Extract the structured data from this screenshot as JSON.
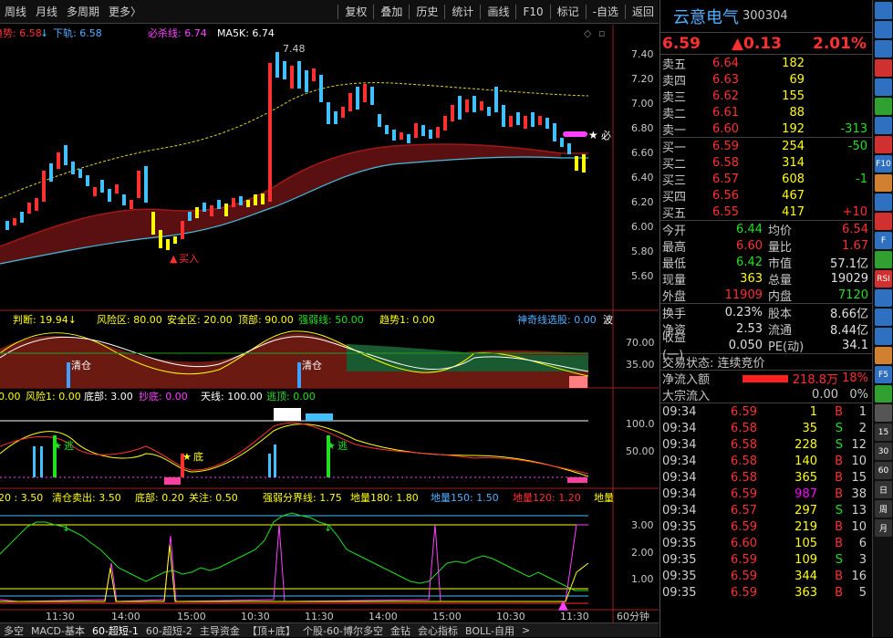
{
  "toolbar": {
    "left": [
      "周线",
      "月线",
      "多周期",
      "更多〉"
    ],
    "right": [
      "复权",
      "叠加",
      "历史",
      "统计",
      "画线",
      "F10",
      "标记",
      "-自选",
      "返回"
    ]
  },
  "main_chart": {
    "legend": [
      {
        "text": "趋势: 6.58",
        "color": "#ff3030"
      },
      {
        "text": "↓",
        "color": "#20c0ff"
      },
      {
        "text": "下轨: 6.58",
        "color": "#50b0ff"
      },
      {
        "text": "必杀线: 6.74",
        "color": "#ff40ff"
      },
      {
        "text": "MA5K: 6.74",
        "color": "#ffffff"
      }
    ],
    "y_labels": [
      "7.40",
      "7.20",
      "7.00",
      "6.80",
      "6.60",
      "6.40",
      "6.20",
      "6.00",
      "5.80",
      "5.60"
    ],
    "high_label": "7.48",
    "buy_label": "买入",
    "sell_mark": "必"
  },
  "indicator1": {
    "legend": [
      {
        "text": "判断: 19.94↓",
        "color": "#ffff00"
      },
      {
        "text": "风险区: 80.00",
        "color": "#ffff00"
      },
      {
        "text": "安全区: 20.00",
        "color": "#ffff00"
      },
      {
        "text": "顶部: 90.00",
        "color": "#ffff00"
      },
      {
        "text": "强弱线: 50.00",
        "color": "#20e020"
      },
      {
        "text": "趋势1: 0.00",
        "color": "#ffff00"
      },
      {
        "text": "神奇线选股: 0.00",
        "color": "#50b0ff"
      },
      {
        "text": "波",
        "color": "#ffffff"
      }
    ],
    "y_labels": [
      "70.00",
      "35.00"
    ],
    "marks": [
      "清仓",
      "清仓"
    ]
  },
  "indicator2": {
    "legend": [
      {
        "text": "0.00",
        "color": "#ffff00"
      },
      {
        "text": "风险1: 0.00",
        "color": "#ffff00"
      },
      {
        "text": "底部: 3.00",
        "color": "#ffffff"
      },
      {
        "text": "抄底: 0.00",
        "color": "#ff40ff"
      },
      {
        "text": "天线: 100.00",
        "color": "#ffffff"
      },
      {
        "text": "逃顶: 0.00",
        "color": "#20e020"
      }
    ],
    "y_labels": [
      "100.0",
      "50.00"
    ],
    "marks": [
      "逃",
      "底",
      "逃"
    ]
  },
  "indicator3": {
    "legend": [
      {
        "text": "20 : 3.50",
        "color": "#ffff00"
      },
      {
        "text": "清仓卖出: 3.50",
        "color": "#ffff00"
      },
      {
        "text": "底部: 0.20",
        "color": "#ffff00"
      },
      {
        "text": "关注: 0.50",
        "color": "#ffff00"
      },
      {
        "text": "强弱分界线: 1.75",
        "color": "#ffff00"
      },
      {
        "text": "地量180: 1.80",
        "color": "#ffff00"
      },
      {
        "text": "地量150: 1.50",
        "color": "#50b0ff"
      },
      {
        "text": "地量120: 1.20",
        "color": "#ff3030"
      },
      {
        "text": "地量",
        "color": "#ffff00"
      }
    ],
    "y_labels": [
      "3.00",
      "2.00",
      "1.00"
    ]
  },
  "time_axis": [
    "11:30",
    "14:00",
    "15:00",
    "10:30",
    "11:30",
    "14:00",
    "15:00",
    "10:30",
    "11:30"
  ],
  "period_label": "60分钟",
  "bottom_tabs": [
    "多空",
    "MACD-基本",
    "60-超短-1",
    "60-超短-2",
    "主导资金",
    "【顶+底】",
    "个股-60-博尔多空",
    "金钻",
    "会心指标",
    "BOLL-自用",
    ">"
  ],
  "active_tab": "60-超短-1",
  "quote": {
    "name": "云意电气",
    "code": "300304",
    "price": "6.59",
    "change": "▲0.13",
    "pct": "2.01%",
    "asks": [
      {
        "label": "卖五",
        "price": "6.64",
        "vol": "182",
        "delta": ""
      },
      {
        "label": "卖四",
        "price": "6.63",
        "vol": "69",
        "delta": ""
      },
      {
        "label": "卖三",
        "price": "6.62",
        "vol": "155",
        "delta": ""
      },
      {
        "label": "卖二",
        "price": "6.61",
        "vol": "88",
        "delta": ""
      },
      {
        "label": "卖一",
        "price": "6.60",
        "vol": "192",
        "delta": "-313"
      }
    ],
    "bids": [
      {
        "label": "买一",
        "price": "6.59",
        "vol": "254",
        "delta": "-50"
      },
      {
        "label": "买二",
        "price": "6.58",
        "vol": "314",
        "delta": ""
      },
      {
        "label": "买三",
        "price": "6.57",
        "vol": "608",
        "delta": "-1"
      },
      {
        "label": "买四",
        "price": "6.56",
        "vol": "467",
        "delta": ""
      },
      {
        "label": "买五",
        "price": "6.55",
        "vol": "417",
        "delta": "+10"
      }
    ],
    "stats": [
      {
        "k1": "今开",
        "v1": "6.44",
        "c1": "green",
        "k2": "均价",
        "v2": "6.54",
        "c2": "red"
      },
      {
        "k1": "最高",
        "v1": "6.60",
        "c1": "red",
        "k2": "量比",
        "v2": "1.67",
        "c2": "red"
      },
      {
        "k1": "最低",
        "v1": "6.42",
        "c1": "green",
        "k2": "市值",
        "v2": "57.1亿",
        "c2": "white"
      },
      {
        "k1": "现量",
        "v1": "363",
        "c1": "yellow",
        "k2": "总量",
        "v2": "19029",
        "c2": "white"
      },
      {
        "k1": "外盘",
        "v1": "11909",
        "c1": "red",
        "k2": "内盘",
        "v2": "7120",
        "c2": "green"
      }
    ],
    "stats2": [
      {
        "k1": "换手",
        "v1": "0.23%",
        "c1": "white",
        "k2": "股本",
        "v2": "8.66亿",
        "c2": "white"
      },
      {
        "k1": "净资",
        "v1": "2.53",
        "c1": "white",
        "k2": "流通",
        "v2": "8.44亿",
        "c2": "white"
      },
      {
        "k1": "收益(一)",
        "v1": "0.050",
        "c1": "white",
        "k2": "PE(动)",
        "v2": "34.1",
        "c2": "white"
      }
    ],
    "trade_status": "交易状态: 连续竞价",
    "net_inflow_label": "净流入额",
    "net_inflow_value": "218.8万",
    "net_inflow_pct": "18%",
    "block_label": "大宗流入",
    "block_value": "0.00",
    "block_pct": "0%",
    "ticks": [
      {
        "t": "09:34",
        "p": "6.59",
        "v": "1",
        "s": "B",
        "n": "1",
        "vc": "yellow"
      },
      {
        "t": "09:34",
        "p": "6.58",
        "v": "35",
        "s": "S",
        "n": "2",
        "vc": "yellow"
      },
      {
        "t": "09:34",
        "p": "6.58",
        "v": "228",
        "s": "S",
        "n": "12",
        "vc": "yellow"
      },
      {
        "t": "09:34",
        "p": "6.58",
        "v": "140",
        "s": "B",
        "n": "10",
        "vc": "yellow"
      },
      {
        "t": "09:34",
        "p": "6.58",
        "v": "365",
        "s": "B",
        "n": "15",
        "vc": "yellow"
      },
      {
        "t": "09:34",
        "p": "6.59",
        "v": "987",
        "s": "B",
        "n": "38",
        "vc": "magenta"
      },
      {
        "t": "09:34",
        "p": "6.57",
        "v": "297",
        "s": "S",
        "n": "13",
        "vc": "yellow"
      },
      {
        "t": "09:35",
        "p": "6.59",
        "v": "219",
        "s": "B",
        "n": "10",
        "vc": "yellow"
      },
      {
        "t": "09:35",
        "p": "6.60",
        "v": "105",
        "s": "B",
        "n": "6",
        "vc": "yellow"
      },
      {
        "t": "09:35",
        "p": "6.59",
        "v": "109",
        "s": "S",
        "n": "3",
        "vc": "yellow"
      },
      {
        "t": "09:35",
        "p": "6.59",
        "v": "344",
        "s": "B",
        "n": "16",
        "vc": "yellow"
      },
      {
        "t": "09:35",
        "p": "6.59",
        "v": "363",
        "s": "B",
        "n": "5",
        "vc": "yellow"
      }
    ],
    "colors": {
      "up": "#ff3030",
      "down": "#20e020",
      "accent": "#50b0ff",
      "vol": "#ffff00"
    }
  },
  "sidebar_icons": [
    "window-icon",
    "grid-icon",
    "minute-chart-icon",
    "table-icon",
    "kline-icon",
    "candle-icon",
    "stock-icon",
    "financial-icon",
    "finance-f10-icon",
    "news-icon",
    "info-icon",
    "depth-icon",
    "f-icon",
    "chart-icon",
    "rsi-icon",
    "zoom-in-icon",
    "zoom-out-icon",
    "move-icon",
    "pen-icon",
    "fs-icon",
    "f5-icon",
    "period-icon",
    "10-icon",
    "30-icon",
    "60-icon",
    "day-icon",
    "week-icon",
    "month-icon"
  ],
  "sidebar_labels": [
    "",
    "",
    "",
    "",
    "",
    "",
    "",
    "",
    "F10",
    "",
    "",
    "",
    "F",
    "",
    "RSI",
    "",
    "",
    "",
    "",
    "F5",
    "",
    "",
    "15",
    "30",
    "60",
    "日",
    "周",
    "月"
  ]
}
